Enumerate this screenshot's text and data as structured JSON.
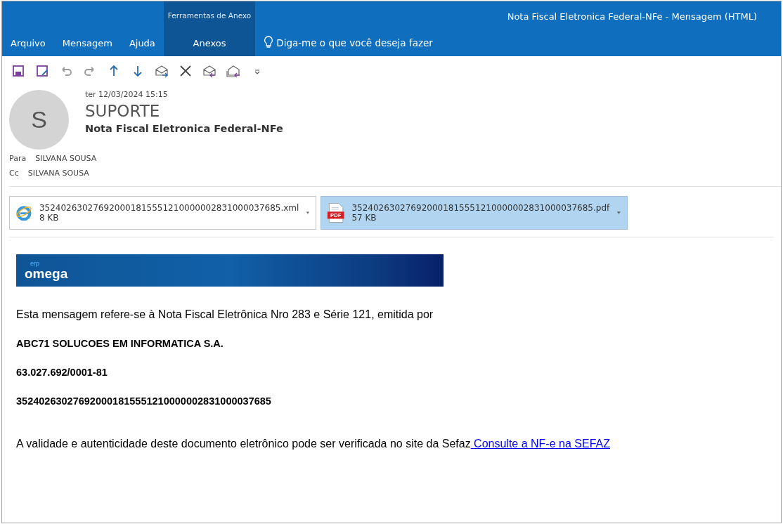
{
  "window": {
    "title": "Nota Fiscal Eletronica Federal-NFe  -  Mensagem (HTML)"
  },
  "context_group": "Ferramentas de Anexo",
  "tabs": [
    {
      "label": "Arquivo",
      "selected": false
    },
    {
      "label": "Mensagem",
      "selected": false
    },
    {
      "label": "Ajuda",
      "selected": false
    },
    {
      "label": "Anexos",
      "selected": true
    }
  ],
  "tell_me": "Diga-me o que você deseja fazer",
  "header": {
    "avatar_letter": "S",
    "date": "ter 12/03/2024 15:15",
    "sender": "SUPORTE",
    "subject": "Nota Fiscal Eletronica Federal-NFe",
    "to_label": "Para",
    "to": "SILVANA SOUSA",
    "cc_label": "Cc",
    "cc": "SILVANA SOUSA"
  },
  "attachments": [
    {
      "kind": "xml",
      "name": "352402630276920001815551210000002831000037685.xml",
      "size": "8 KB",
      "selected": false
    },
    {
      "kind": "pdf",
      "icon_label": "PDF",
      "name": "352402630276920001815551210000002831000037685.pdf",
      "size": "57 KB",
      "selected": true
    }
  ],
  "banner": {
    "logo_small": "erp",
    "logo": "omega"
  },
  "body": [
    {
      "kind": "text",
      "text": "Esta mensagem refere-se à Nota Fiscal Eletrônica Nro 283 e Série 121, emitida por"
    },
    {
      "kind": "bold",
      "text": "ABC71 SOLUCOES EM INFORMATICA S.A."
    },
    {
      "kind": "bold",
      "text": "63.027.692/0001-81"
    },
    {
      "kind": "bold",
      "text": "352402630276920001815551210000002831000037685"
    },
    {
      "kind": "link_text",
      "text": "A validade e autenticidade deste documento eletrônico pode ser verificada no site da Sefaz",
      "link": " Consulte a NF-e na SEFAZ"
    }
  ]
}
